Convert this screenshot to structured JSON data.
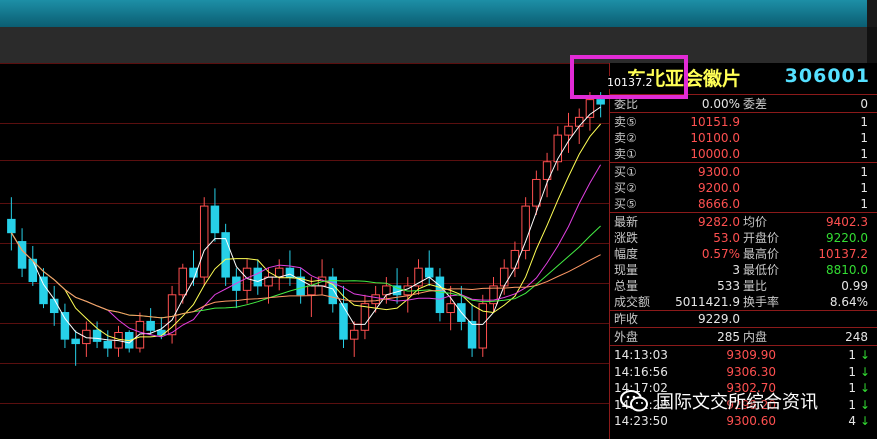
{
  "stock": {
    "name": "东北亚会徽片",
    "code": "306001",
    "price_tag": "10137.2"
  },
  "quote": {
    "weibi": {
      "label": "委比",
      "value": "0.00%"
    },
    "weicha": {
      "label": "委差",
      "value": "0"
    },
    "sell": [
      {
        "label": "卖⑤",
        "price": "10151.9",
        "vol": "1"
      },
      {
        "label": "卖②",
        "price": "10100.0",
        "vol": "1"
      },
      {
        "label": "卖①",
        "price": "10000.0",
        "vol": "1"
      }
    ],
    "buy": [
      {
        "label": "买①",
        "price": "9300.0",
        "vol": "1"
      },
      {
        "label": "买②",
        "price": "9200.0",
        "vol": "1"
      },
      {
        "label": "买⑤",
        "price": "8666.0",
        "vol": "1"
      }
    ],
    "stats": [
      {
        "l1": "最新",
        "v1": "9282.0",
        "c1": "red",
        "l2": "均价",
        "v2": "9402.3",
        "c2": "red"
      },
      {
        "l1": "涨跌",
        "v1": "53.0",
        "c1": "red",
        "l2": "开盘价",
        "v2": "9220.0",
        "c2": "green"
      },
      {
        "l1": "幅度",
        "v1": "0.57%",
        "c1": "red",
        "l2": "最高价",
        "v2": "10137.2",
        "c2": "red"
      },
      {
        "l1": "现量",
        "v1": "3",
        "c1": "white",
        "l2": "最低价",
        "v2": "8810.0",
        "c2": "green"
      },
      {
        "l1": "总量",
        "v1": "533",
        "c1": "white",
        "l2": "量比",
        "v2": "0.99",
        "c2": "white"
      },
      {
        "l1": "成交额",
        "v1": "5011421.9",
        "c1": "white",
        "l2": "换手率",
        "v2": "8.64%",
        "c2": "white"
      }
    ],
    "zuoshou": {
      "label": "昨收",
      "value": "9229.0"
    },
    "waipan": {
      "label": "外盘",
      "value": "285"
    },
    "neipan": {
      "label": "内盘",
      "value": "248"
    }
  },
  "ticks": [
    {
      "time": "14:13:03",
      "price": "9309.90",
      "vol": "1",
      "dir": "↓"
    },
    {
      "time": "14:16:56",
      "price": "9306.30",
      "vol": "1",
      "dir": "↓"
    },
    {
      "time": "14:17:02",
      "price": "9302.70",
      "vol": "1",
      "dir": "↓"
    },
    {
      "time": "14:22:28",
      "price": "9298.20",
      "vol": "1",
      "dir": "↓"
    },
    {
      "time": "14:23:50",
      "price": "9300.60",
      "vol": "4",
      "dir": "↓"
    }
  ],
  "watermark": "国际文交所综合资讯",
  "colors": {
    "up": "#ff5050",
    "down": "#33dd33",
    "accent": "#e22bd6"
  },
  "candles": [
    [
      9850,
      9900,
      9780,
      9820
    ],
    [
      9800,
      9830,
      9720,
      9740
    ],
    [
      9760,
      9790,
      9700,
      9710
    ],
    [
      9720,
      9740,
      9650,
      9660
    ],
    [
      9670,
      9700,
      9610,
      9640
    ],
    [
      9640,
      9660,
      9560,
      9580
    ],
    [
      9580,
      9600,
      9520,
      9570
    ],
    [
      9570,
      9620,
      9540,
      9600
    ],
    [
      9600,
      9620,
      9560,
      9575
    ],
    [
      9575,
      9600,
      9540,
      9560
    ],
    [
      9560,
      9610,
      9540,
      9595
    ],
    [
      9595,
      9600,
      9550,
      9560
    ],
    [
      9560,
      9640,
      9550,
      9620
    ],
    [
      9620,
      9650,
      9590,
      9600
    ],
    [
      9600,
      9630,
      9580,
      9590
    ],
    [
      9590,
      9700,
      9570,
      9680
    ],
    [
      9680,
      9750,
      9660,
      9740
    ],
    [
      9740,
      9780,
      9700,
      9720
    ],
    [
      9720,
      9900,
      9700,
      9880
    ],
    [
      9880,
      9920,
      9800,
      9820
    ],
    [
      9820,
      9840,
      9700,
      9720
    ],
    [
      9720,
      9740,
      9650,
      9690
    ],
    [
      9690,
      9760,
      9660,
      9740
    ],
    [
      9740,
      9760,
      9680,
      9700
    ],
    [
      9700,
      9740,
      9660,
      9720
    ],
    [
      9720,
      9760,
      9690,
      9740
    ],
    [
      9740,
      9780,
      9700,
      9720
    ],
    [
      9720,
      9740,
      9660,
      9680
    ],
    [
      9680,
      9720,
      9630,
      9700
    ],
    [
      9700,
      9760,
      9680,
      9720
    ],
    [
      9720,
      9740,
      9640,
      9660
    ],
    [
      9660,
      9700,
      9560,
      9580
    ],
    [
      9580,
      9620,
      9540,
      9600
    ],
    [
      9600,
      9680,
      9580,
      9660
    ],
    [
      9660,
      9700,
      9640,
      9680
    ],
    [
      9680,
      9720,
      9660,
      9700
    ],
    [
      9700,
      9740,
      9660,
      9680
    ],
    [
      9680,
      9720,
      9640,
      9700
    ],
    [
      9700,
      9760,
      9680,
      9740
    ],
    [
      9740,
      9780,
      9700,
      9720
    ],
    [
      9720,
      9740,
      9620,
      9640
    ],
    [
      9640,
      9700,
      9600,
      9660
    ],
    [
      9660,
      9700,
      9600,
      9620
    ],
    [
      9620,
      9660,
      9540,
      9560
    ],
    [
      9560,
      9680,
      9540,
      9660
    ],
    [
      9660,
      9720,
      9640,
      9700
    ],
    [
      9700,
      9760,
      9680,
      9740
    ],
    [
      9740,
      9800,
      9720,
      9780
    ],
    [
      9780,
      9900,
      9760,
      9880
    ],
    [
      9880,
      9960,
      9860,
      9940
    ],
    [
      9940,
      10000,
      9900,
      9980
    ],
    [
      9980,
      10060,
      9960,
      10040
    ],
    [
      10040,
      10090,
      10000,
      10060
    ],
    [
      10060,
      10100,
      10020,
      10080
    ],
    [
      10080,
      10137,
      10050,
      10120
    ],
    [
      10120,
      10137,
      10080,
      10110
    ]
  ]
}
